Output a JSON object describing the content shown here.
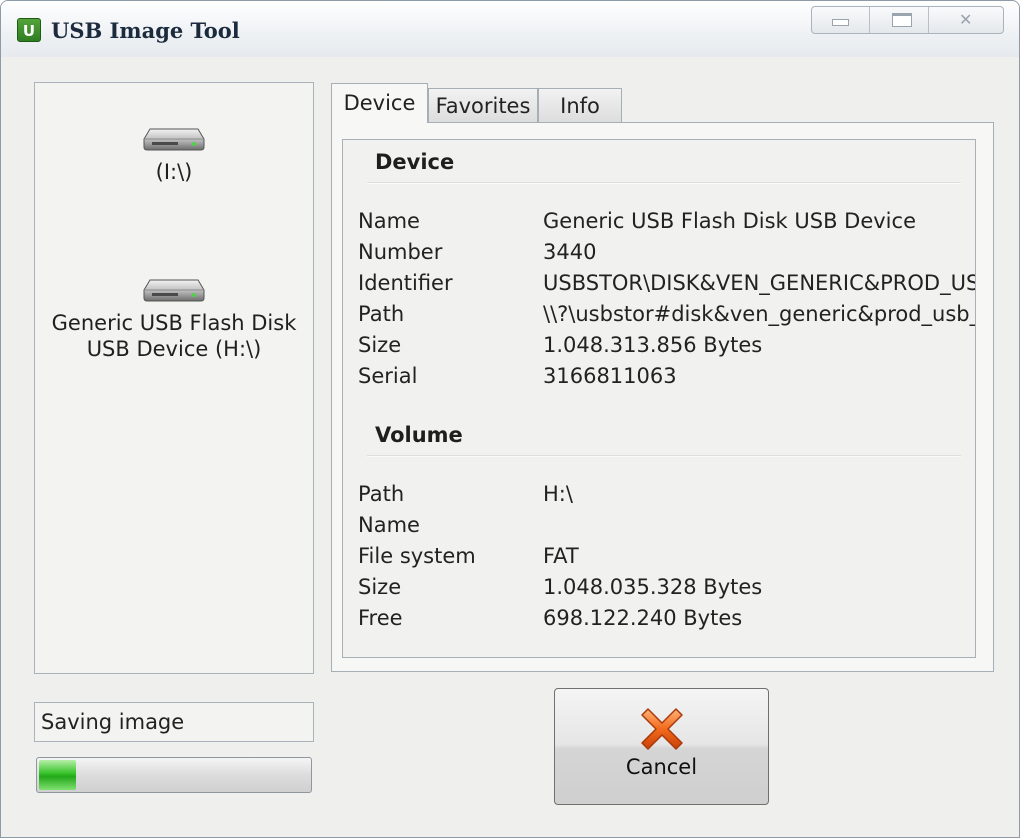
{
  "window": {
    "title": "USB Image Tool",
    "icon_letter": "U",
    "caption_buttons": [
      "minimize",
      "maximize",
      "close"
    ],
    "close_glyph": "✕"
  },
  "drives": [
    {
      "label": "(I:\\)",
      "icon": "usb-drive-icon"
    },
    {
      "label": "Generic USB Flash Disk USB Device (H:\\)",
      "icon": "usb-drive-icon"
    }
  ],
  "tabs": [
    {
      "label": "Device",
      "active": true
    },
    {
      "label": "Favorites",
      "active": false
    },
    {
      "label": "Info",
      "active": false
    }
  ],
  "device_section": {
    "title": "Device",
    "rows": [
      {
        "key": "Name",
        "value": "Generic USB Flash Disk USB Device"
      },
      {
        "key": "Number",
        "value": "3440"
      },
      {
        "key": "Identifier",
        "value": "USBSTOR\\DISK&VEN_GENERIC&PROD_USB_FLASH_DISK"
      },
      {
        "key": "Path",
        "value": "\\\\?\\usbstor#disk&ven_generic&prod_usb_flash_disk"
      },
      {
        "key": "Size",
        "value": "1.048.313.856 Bytes"
      },
      {
        "key": "Serial",
        "value": "3166811063"
      }
    ]
  },
  "volume_section": {
    "title": "Volume",
    "rows": [
      {
        "key": "Path",
        "value": "H:\\"
      },
      {
        "key": "Name",
        "value": ""
      },
      {
        "key": "File system",
        "value": "FAT"
      },
      {
        "key": "Size",
        "value": "1.048.035.328 Bytes"
      },
      {
        "key": "Free",
        "value": "698.122.240 Bytes"
      }
    ]
  },
  "status": {
    "text": "Saving image",
    "progress": 0.15
  },
  "cancel_button": {
    "label": "Cancel",
    "icon": "red-x-icon"
  },
  "colors": {
    "progress_green": "#2fb825",
    "cancel_icon_orange": "#f26a1b",
    "app_icon_green": "#3b8f2c"
  }
}
